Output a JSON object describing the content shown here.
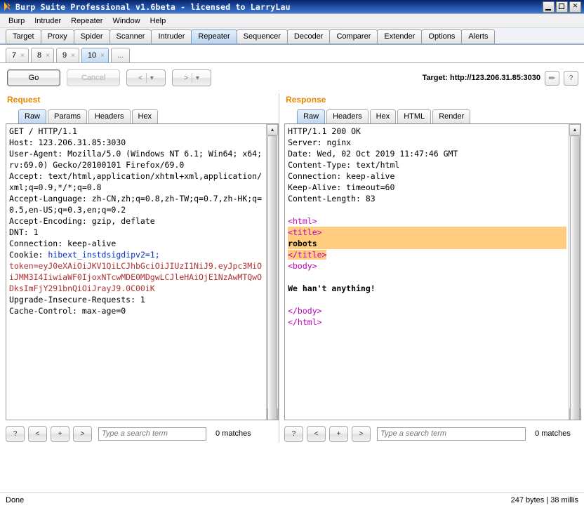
{
  "window": {
    "title": "Burp Suite Professional v1.6beta - licensed to LarryLau",
    "icon": "burp-icon",
    "minimize": "_",
    "maximize": "□",
    "close": "✕"
  },
  "menubar": [
    "Burp",
    "Intruder",
    "Repeater",
    "Window",
    "Help"
  ],
  "main_tabs": [
    {
      "label": "Target",
      "active": false
    },
    {
      "label": "Proxy",
      "active": false
    },
    {
      "label": "Spider",
      "active": false
    },
    {
      "label": "Scanner",
      "active": false
    },
    {
      "label": "Intruder",
      "active": false
    },
    {
      "label": "Repeater",
      "active": true
    },
    {
      "label": "Sequencer",
      "active": false
    },
    {
      "label": "Decoder",
      "active": false
    },
    {
      "label": "Comparer",
      "active": false
    },
    {
      "label": "Extender",
      "active": false
    },
    {
      "label": "Options",
      "active": false
    },
    {
      "label": "Alerts",
      "active": false
    }
  ],
  "repeater_tabs": [
    {
      "label": "7",
      "close": "×",
      "active": false
    },
    {
      "label": "8",
      "close": "×",
      "active": false
    },
    {
      "label": "9",
      "close": "×",
      "active": false
    },
    {
      "label": "10",
      "close": "×",
      "active": true
    }
  ],
  "repeater_tab_more": "...",
  "toolbar": {
    "go_label": "Go",
    "cancel_label": "Cancel",
    "back_label": "<",
    "forward_label": ">",
    "dropdown_caret": "▾",
    "target_label": "Target: http://123.206.31.85:3030",
    "edit_icon": "pencil-icon",
    "help_icon": "?"
  },
  "request": {
    "title": "Request",
    "tabs": [
      {
        "label": "Raw",
        "active": true
      },
      {
        "label": "Params",
        "active": false
      },
      {
        "label": "Headers",
        "active": false
      },
      {
        "label": "Hex",
        "active": false
      }
    ],
    "lines": [
      {
        "text": "GET / HTTP/1.1",
        "style": "plain"
      },
      {
        "text": "Host: 123.206.31.85:3030",
        "style": "plain"
      },
      {
        "text": "User-Agent: Mozilla/5.0 (Windows NT 6.1; Win64; x64; rv:69.0) Gecko/20100101 Firefox/69.0",
        "style": "plain"
      },
      {
        "text": "Accept: text/html,application/xhtml+xml,application/xml;q=0.9,*/*;q=0.8",
        "style": "plain"
      },
      {
        "text": "Accept-Language: zh-CN,zh;q=0.8,zh-TW;q=0.7,zh-HK;q=0.5,en-US;q=0.3,en;q=0.2",
        "style": "plain"
      },
      {
        "text": "Accept-Encoding: gzip, deflate",
        "style": "plain"
      },
      {
        "text": "DNT: 1",
        "style": "plain"
      },
      {
        "text": "Connection: keep-alive",
        "style": "plain"
      }
    ],
    "cookie_prefix": "Cookie: ",
    "cookie_name": "hibext_instdsigdipv2=1;",
    "token_text": "token=eyJ0eXAiOiJKV1QiLCJhbGciOiJIUzI1NiJ9.eyJpc3MiOiJMM3I4IiwiaWF0IjoxNTcwMDE0MDgwLCJleHAiOjE1NzAwMTQwODksImFjY291bnQiOiJrayJ9.0C00iK",
    "tail_lines": [
      "Upgrade-Insecure-Requests: 1",
      "Cache-Control: max-age=0"
    ],
    "search": {
      "help_label": "?",
      "prev_label": "<",
      "add_label": "+",
      "next_label": ">",
      "placeholder": "Type a search term",
      "value": "",
      "matches": "0 matches"
    }
  },
  "response": {
    "title": "Response",
    "tabs": [
      {
        "label": "Raw",
        "active": true
      },
      {
        "label": "Headers",
        "active": false
      },
      {
        "label": "Hex",
        "active": false
      },
      {
        "label": "HTML",
        "active": false
      },
      {
        "label": "Render",
        "active": false
      }
    ],
    "header_lines": [
      "HTTP/1.1 200 OK",
      "Server: nginx",
      "Date: Wed, 02 Oct 2019 11:47:46 GMT",
      "Content-Type: text/html",
      "Connection: keep-alive",
      "Keep-Alive: timeout=60",
      "Content-Length: 83"
    ],
    "body": {
      "html_open": "<html>",
      "title_open": "<title>",
      "title_text": "robots",
      "title_close": "</title>",
      "body_open": "<body>",
      "message": "We han't anything!",
      "body_close": "</body>",
      "html_close": "</html>"
    },
    "search": {
      "help_label": "?",
      "prev_label": "<",
      "add_label": "+",
      "next_label": ">",
      "placeholder": "Type a search term",
      "value": "",
      "matches": "0 matches"
    }
  },
  "statusbar": {
    "left": "Done",
    "right": "247 bytes | 38 millis"
  },
  "colors": {
    "pane_title": "#e58700",
    "highlight": "#ffcc80",
    "tag": "#c000c0",
    "cookie_blue": "#0033cc",
    "token_red": "#b03030",
    "titlebar": "#1b4b9e"
  }
}
